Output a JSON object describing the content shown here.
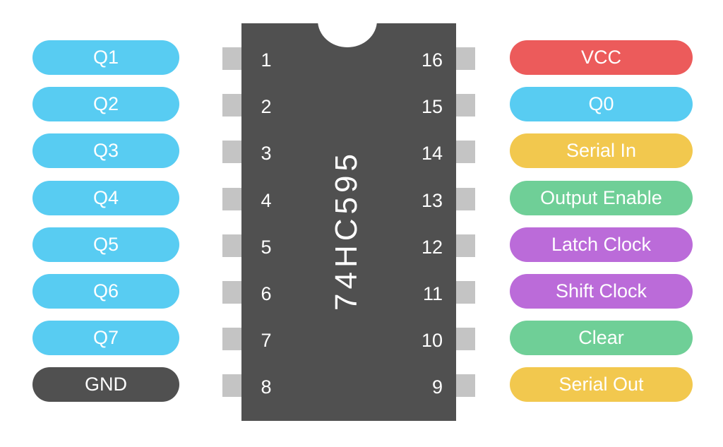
{
  "title": "74HC595",
  "colors": {
    "chip": "#505050",
    "pin_tab": "#c4c4c4",
    "output": "#58ccf2",
    "power": "#ec5b5b",
    "data": "#f2c84e",
    "control": "#6fcf97",
    "clock": "#bb6bd9",
    "ground": "#505050"
  },
  "left_pins": [
    {
      "number": "1",
      "label": "Q1",
      "color": "#58ccf2"
    },
    {
      "number": "2",
      "label": "Q2",
      "color": "#58ccf2"
    },
    {
      "number": "3",
      "label": "Q3",
      "color": "#58ccf2"
    },
    {
      "number": "4",
      "label": "Q4",
      "color": "#58ccf2"
    },
    {
      "number": "5",
      "label": "Q5",
      "color": "#58ccf2"
    },
    {
      "number": "6",
      "label": "Q6",
      "color": "#58ccf2"
    },
    {
      "number": "7",
      "label": "Q7",
      "color": "#58ccf2"
    },
    {
      "number": "8",
      "label": "GND",
      "color": "#505050"
    }
  ],
  "right_pins": [
    {
      "number": "16",
      "label": "VCC",
      "color": "#ec5b5b"
    },
    {
      "number": "15",
      "label": "Q0",
      "color": "#58ccf2"
    },
    {
      "number": "14",
      "label": "Serial In",
      "color": "#f2c84e"
    },
    {
      "number": "13",
      "label": "Output Enable",
      "color": "#6fcf97"
    },
    {
      "number": "12",
      "label": "Latch Clock",
      "color": "#bb6bd9"
    },
    {
      "number": "11",
      "label": "Shift Clock",
      "color": "#bb6bd9"
    },
    {
      "number": "10",
      "label": "Clear",
      "color": "#6fcf97"
    },
    {
      "number": "9",
      "label": "Serial Out",
      "color": "#f2c84e"
    }
  ]
}
